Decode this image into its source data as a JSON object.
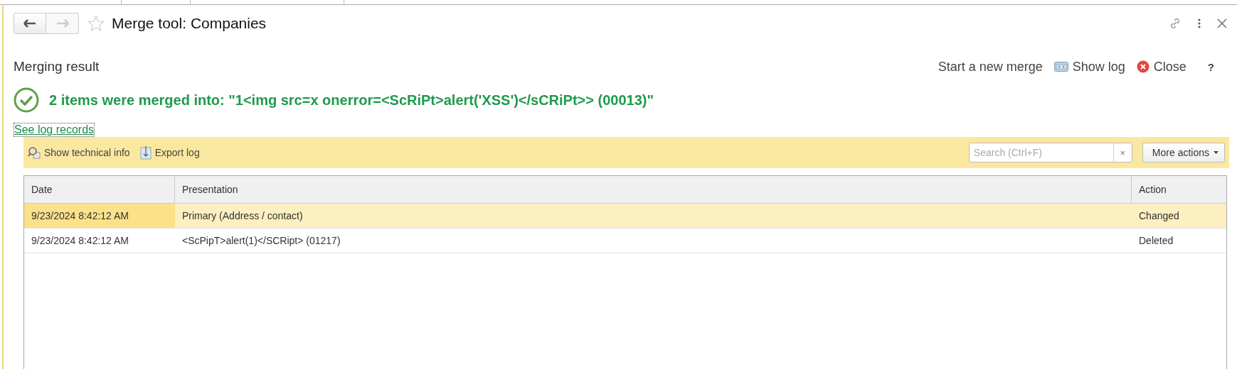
{
  "window": {
    "title": "Merge tool: Companies",
    "favorite": false,
    "back_enabled": true,
    "forward_enabled": false
  },
  "heading": "Merging result",
  "commands": [
    {
      "kind": "text",
      "label": "Start a new merge"
    },
    {
      "kind": "log",
      "label": "Show log"
    },
    {
      "kind": "close",
      "label": "Close"
    },
    {
      "kind": "help",
      "label": "?"
    }
  ],
  "message": "2 items were merged into: \"1<img src=x onerror=<ScRiPt>alert('XSS')</sCRiPt>> (00013)\"",
  "link": "See log records",
  "toolbar": {
    "buttons": [
      {
        "kind": "info",
        "label": "Show technical info"
      },
      {
        "kind": "export",
        "label": "Export log"
      }
    ],
    "search": {
      "placeholder": "Search (Ctrl+F)",
      "clear": "×"
    },
    "more": "More actions"
  },
  "table": {
    "columns": [
      "Date",
      "Presentation",
      "Action"
    ],
    "rows": [
      {
        "cells": [
          "9/23/2024 8:42:12 AM",
          "Primary (Address / contact)",
          "Changed"
        ],
        "selected": true
      },
      {
        "cells": [
          "9/23/2024 8:42:12 AM",
          "<ScPipT>alert(1)</SCRipt> (01217)",
          "Deleted"
        ],
        "selected": false
      }
    ]
  }
}
